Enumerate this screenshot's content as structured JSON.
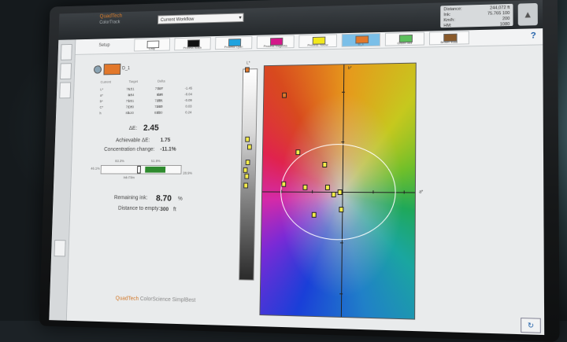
{
  "app": {
    "brand": "QuadTech",
    "subtitle": "ColorTrack",
    "profile": "Current Workflow"
  },
  "readout": {
    "rows": [
      {
        "k": "Distance:",
        "v": "244,072 ft"
      },
      {
        "k": "Ink:",
        "v": "75.765 100"
      },
      {
        "k": "Km/h:",
        "v": "200"
      },
      {
        "k": "HM:",
        "v": "1080"
      }
    ]
  },
  "toolbar": {
    "label": "Setup",
    "swatches": [
      {
        "label": "Gray",
        "color": "#ffffff",
        "active": false
      },
      {
        "label": "Process Black",
        "color": "#111111",
        "active": false
      },
      {
        "label": "Process Cyan",
        "color": "#1fa3df",
        "active": false
      },
      {
        "label": "Process Magenta",
        "color": "#d4188a",
        "active": false
      },
      {
        "label": "Process Yellow",
        "color": "#f2e81c",
        "active": false
      },
      {
        "label": "D_1",
        "color": "#e2782b",
        "active": true
      },
      {
        "label": "Green 354",
        "color": "#5cbf5c",
        "active": false
      },
      {
        "label": "Brown 4666",
        "color": "#8a5a2a",
        "active": false
      }
    ],
    "help": "?"
  },
  "panel": {
    "target_name": "D_1",
    "headers": [
      "Current",
      "Target",
      "Delta"
    ],
    "lab_rows": [
      [
        "L*",
        "76.21",
        "L*",
        "77.67",
        "dL*",
        "-1.45"
      ],
      [
        "a*",
        "8.84",
        "a*",
        "9.98",
        "da*",
        "-0.04"
      ],
      [
        "b*",
        "71.21",
        "b*",
        "72.51",
        "db*",
        "-0.09"
      ],
      [
        "C*",
        "72.80",
        "C*",
        "72.80",
        "dC*",
        "0.03"
      ],
      [
        "h",
        "83.20",
        "h",
        "83.20",
        "dh",
        "0.24"
      ]
    ],
    "delta_e_label": "ΔE:",
    "delta_e": "2.45",
    "achievable_label": "Achievable ΔE:",
    "achievable": "1.75",
    "conc_label": "Concentration change:",
    "conc": "-11.1%",
    "gauge_left": "46.1%",
    "gauge_top_left": "83.3%",
    "gauge_top_right": "51.9%",
    "gauge_right": "28.9%",
    "gauge_caption": "Ink Film",
    "gauge_fill": 0.26,
    "remaining_label": "Remaining ink:",
    "remaining": "8.70",
    "remaining_unit": "%",
    "distance_label": "Distance to empty:",
    "distance": "300",
    "distance_unit": "ft",
    "logo_brand": "QuadTech",
    "logo_partner": "ColorScience",
    "logo_product": "SimplBest"
  },
  "plot": {
    "axis_l": "L*",
    "axis_a": "a*",
    "axis_b": "b*"
  }
}
